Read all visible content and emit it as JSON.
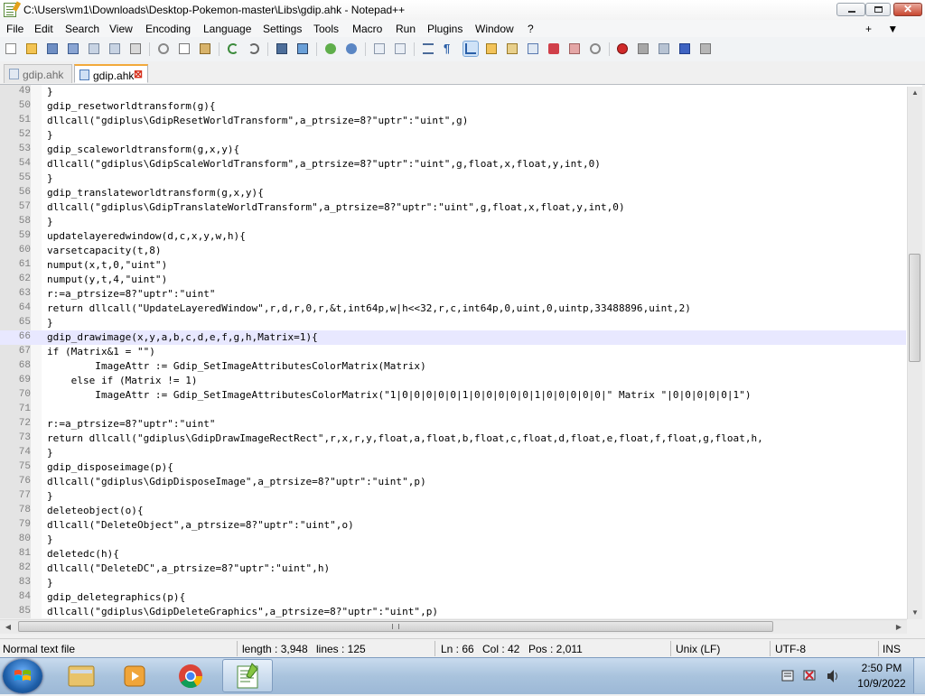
{
  "window": {
    "title": "C:\\Users\\vm1\\Downloads\\Desktop-Pokemon-master\\Libs\\gdip.ahk - Notepad++",
    "controls": {
      "minimize": "",
      "maximize": "",
      "close": "✕"
    }
  },
  "menu": {
    "items": [
      "File",
      "Edit",
      "Search",
      "View",
      "Encoding",
      "Language",
      "Settings",
      "Tools",
      "Macro",
      "Run",
      "Plugins",
      "Window",
      "?"
    ],
    "right": [
      "+",
      "▼",
      "✕"
    ]
  },
  "toolbar": {
    "icons": [
      "new-file-icon",
      "open-file-icon",
      "save-icon",
      "save-all-icon",
      "close-icon",
      "close-all-icon",
      "print-icon",
      "cut-icon",
      "copy-icon",
      "paste-icon",
      "undo-icon",
      "redo-icon",
      "find-icon",
      "replace-icon",
      "zoom-in-icon",
      "zoom-out-icon",
      "sync-vertical-icon",
      "sync-horizontal-icon",
      "word-wrap-icon",
      "show-all-chars-icon",
      "indent-guide-icon",
      "udl-icon",
      "doc-map-icon",
      "function-list-icon",
      "folder-workspace-icon",
      "monitoring-icon",
      "record-macro-icon",
      "stop-macro-icon",
      "play-macro-icon",
      "run-macro-multiple-icon",
      "save-macro-icon"
    ]
  },
  "tabs": [
    {
      "label": "gdip.ahk",
      "active": false
    },
    {
      "label": "gdip.ahk",
      "active": true
    }
  ],
  "editor": {
    "current_line": 66,
    "lines": [
      {
        "n": "49",
        "text": "}"
      },
      {
        "n": "50",
        "text": "gdip_resetworldtransform(g){"
      },
      {
        "n": "51",
        "text": "dllcall(\"gdiplus\\GdipResetWorldTransform\",a_ptrsize=8?\"uptr\":\"uint\",g)"
      },
      {
        "n": "52",
        "text": "}"
      },
      {
        "n": "53",
        "text": "gdip_scaleworldtransform(g,x,y){"
      },
      {
        "n": "54",
        "text": "dllcall(\"gdiplus\\GdipScaleWorldTransform\",a_ptrsize=8?\"uptr\":\"uint\",g,float,x,float,y,int,0)"
      },
      {
        "n": "55",
        "text": "}"
      },
      {
        "n": "56",
        "text": "gdip_translateworldtransform(g,x,y){"
      },
      {
        "n": "57",
        "text": "dllcall(\"gdiplus\\GdipTranslateWorldTransform\",a_ptrsize=8?\"uptr\":\"uint\",g,float,x,float,y,int,0)"
      },
      {
        "n": "58",
        "text": "}"
      },
      {
        "n": "59",
        "text": "updatelayeredwindow(d,c,x,y,w,h){"
      },
      {
        "n": "60",
        "text": "varsetcapacity(t,8)"
      },
      {
        "n": "61",
        "text": "numput(x,t,0,\"uint\")"
      },
      {
        "n": "62",
        "text": "numput(y,t,4,\"uint\")"
      },
      {
        "n": "63",
        "text": "r:=a_ptrsize=8?\"uptr\":\"uint\""
      },
      {
        "n": "64",
        "text": "return dllcall(\"UpdateLayeredWindow\",r,d,r,0,r,&t,int64p,w|h<<32,r,c,int64p,0,uint,0,uintp,33488896,uint,2)"
      },
      {
        "n": "65",
        "text": "}"
      },
      {
        "n": "66",
        "text": "gdip_drawimage(x,y,a,b,c,d,e,f,g,h,Matrix=1){"
      },
      {
        "n": "67",
        "text": "if (Matrix&1 = \"\")"
      },
      {
        "n": "68",
        "text": "        ImageAttr := Gdip_SetImageAttributesColorMatrix(Matrix)"
      },
      {
        "n": "69",
        "text": "    else if (Matrix != 1)"
      },
      {
        "n": "70",
        "text": "        ImageAttr := Gdip_SetImageAttributesColorMatrix(\"1|0|0|0|0|0|1|0|0|0|0|0|1|0|0|0|0|0|\" Matrix \"|0|0|0|0|0|1\")"
      },
      {
        "n": "71",
        "text": ""
      },
      {
        "n": "72",
        "text": "r:=a_ptrsize=8?\"uptr\":\"uint\""
      },
      {
        "n": "73",
        "text": "return dllcall(\"gdiplus\\GdipDrawImageRectRect\",r,x,r,y,float,a,float,b,float,c,float,d,float,e,float,f,float,g,float,h,"
      },
      {
        "n": "74",
        "text": "}"
      },
      {
        "n": "75",
        "text": "gdip_disposeimage(p){"
      },
      {
        "n": "76",
        "text": "dllcall(\"gdiplus\\GdipDisposeImage\",a_ptrsize=8?\"uptr\":\"uint\",p)"
      },
      {
        "n": "77",
        "text": "}"
      },
      {
        "n": "78",
        "text": "deleteobject(o){"
      },
      {
        "n": "79",
        "text": "dllcall(\"DeleteObject\",a_ptrsize=8?\"uptr\":\"uint\",o)"
      },
      {
        "n": "80",
        "text": "}"
      },
      {
        "n": "81",
        "text": "deletedc(h){"
      },
      {
        "n": "82",
        "text": "dllcall(\"DeleteDC\",a_ptrsize=8?\"uptr\":\"uint\",h)"
      },
      {
        "n": "83",
        "text": "}"
      },
      {
        "n": "84",
        "text": "gdip_deletegraphics(p){"
      },
      {
        "n": "85",
        "text": "dllcall(\"gdiplus\\GdipDeleteGraphics\",a_ptrsize=8?\"uptr\":\"uint\",p)"
      }
    ]
  },
  "statusbar": {
    "file_type": "Normal text file",
    "length": "length : 3,948",
    "lines": "lines : 125",
    "ln": "Ln : 66",
    "col": "Col : 42",
    "pos": "Pos : 2,011",
    "eol": "Unix (LF)",
    "encoding": "UTF-8",
    "ins": "INS"
  },
  "taskbar": {
    "apps": [
      "windows-explorer-icon",
      "media-player-icon",
      "chrome-icon",
      "notepad-plus-plus-icon"
    ],
    "tray_icons": [
      "action-center-icon",
      "network-icon",
      "volume-icon"
    ],
    "time": "2:50 PM",
    "date": "10/9/2022"
  }
}
